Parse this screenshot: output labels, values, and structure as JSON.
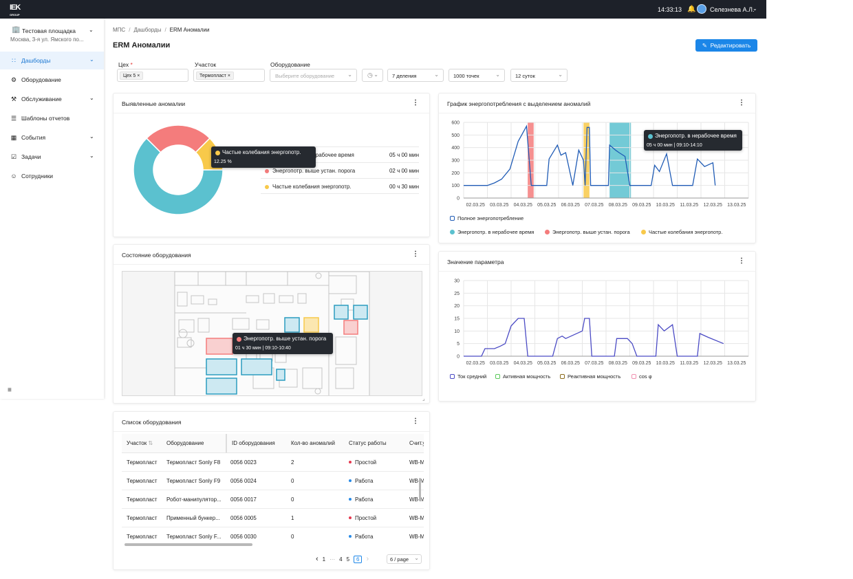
{
  "topbar": {
    "logo": "IEK",
    "logo_sub": "GROUP",
    "time": "14:33:13",
    "user": "Селезнева А.Л."
  },
  "sidebar": {
    "org_name": "Тестовая площадка",
    "org_address": "Москва, 3-я ул. Ямского по...",
    "items": [
      {
        "label": "Дашборды",
        "icon": "chart-icon",
        "expandable": true,
        "active": true
      },
      {
        "label": "Оборудование",
        "icon": "gear-icon",
        "expandable": false
      },
      {
        "label": "Обслуживание",
        "icon": "wrench-icon",
        "expandable": true
      },
      {
        "label": "Шаблоны отчетов",
        "icon": "document-icon",
        "expandable": false
      },
      {
        "label": "События",
        "icon": "calendar-icon",
        "expandable": true
      },
      {
        "label": "Задачи",
        "icon": "tasks-icon",
        "expandable": true
      },
      {
        "label": "Сотрудники",
        "icon": "user-icon",
        "expandable": false
      }
    ]
  },
  "breadcrumb": {
    "items": [
      "МПС",
      "Дашборды",
      "ERM Аномалии"
    ]
  },
  "page": {
    "title": "ERM Аномалии",
    "edit_label": "Редактировать"
  },
  "filters": {
    "workshop": {
      "label": "Цех",
      "required_mark": "*",
      "tag": "Цех 5"
    },
    "area": {
      "label": "Участок",
      "tag": "Термопласт"
    },
    "equipment": {
      "label": "Оборудование",
      "placeholder": "Выберите оборудование"
    },
    "divisions": "7 деления",
    "points": "1000 точек",
    "period": "12 суток"
  },
  "anomalies": {
    "title": "Выявленные аномалии",
    "legend": [
      {
        "name": "Энергопотр. в нерабочее время",
        "duration": "05 ч 00 мин",
        "color": "#5bc1cf"
      },
      {
        "name": "Энергопотр. выше устан. порога",
        "duration": "02 ч 00 мин",
        "color": "#f47c7c"
      },
      {
        "name": "Частые колебания энергопотр.",
        "duration": "00 ч 30 мин",
        "color": "#f8c94a"
      }
    ],
    "shares": [
      62.5,
      25,
      12.5
    ],
    "tooltip": {
      "name": "Частые колебания энергопотр.",
      "value": "12.25 %"
    }
  },
  "energy_chart": {
    "title": "График энергопотребления с выделением аномалий",
    "legend_total": "Полное энергопотребление",
    "tooltip": {
      "name": "Энергопотр. в нерабочее время",
      "detail": "05 ч 00 мин | 09:10-14:10"
    }
  },
  "param_chart": {
    "title": "Значение параметра",
    "legend": [
      "Ток средний",
      "Активная мощность",
      "Реактивная мощность",
      "cos φ"
    ],
    "legend_colors": [
      "#4a4ac4",
      "#5ac85a",
      "#8a6a1a",
      "#f090b0"
    ]
  },
  "chart_data": [
    {
      "type": "line",
      "title": "График энергопотребления с выделением аномалий",
      "x": [
        "02.03.25",
        "03.03.25",
        "04.03.25",
        "05.03.25",
        "06.03.25",
        "07.03.25",
        "08.03.25",
        "09.03.25",
        "10.03.25",
        "11.03.25",
        "12.03.25",
        "13.03.25"
      ],
      "ylim": [
        0,
        600
      ],
      "yticks": [
        0,
        100,
        200,
        300,
        400,
        500,
        600
      ],
      "xlim": [
        0,
        12
      ],
      "grid": true,
      "series": [
        {
          "name": "Полное энергопотребление",
          "color": "#1f5bb5",
          "points": [
            [
              0,
              100
            ],
            [
              1,
              100
            ],
            [
              1.3,
              120
            ],
            [
              1.6,
              150
            ],
            [
              1.95,
              230
            ],
            [
              2.3,
              450
            ],
            [
              2.65,
              570
            ],
            [
              2.85,
              100
            ],
            [
              3.5,
              100
            ],
            [
              3.6,
              310
            ],
            [
              3.95,
              420
            ],
            [
              4.1,
              340
            ],
            [
              4.3,
              360
            ],
            [
              4.6,
              100
            ],
            [
              4.85,
              380
            ],
            [
              5.05,
              300
            ],
            [
              5.12,
              100
            ],
            [
              5.2,
              560
            ],
            [
              5.3,
              560
            ],
            [
              5.35,
              100
            ],
            [
              6.1,
              100
            ],
            [
              6.15,
              420
            ],
            [
              6.4,
              380
            ],
            [
              6.55,
              360
            ],
            [
              6.8,
              330
            ],
            [
              7.0,
              100
            ],
            [
              7.9,
              100
            ],
            [
              8.05,
              260
            ],
            [
              8.25,
              210
            ],
            [
              8.55,
              350
            ],
            [
              8.8,
              100
            ],
            [
              9.65,
              100
            ],
            [
              9.85,
              310
            ],
            [
              10.15,
              250
            ],
            [
              10.5,
              280
            ],
            [
              10.6,
              100
            ]
          ]
        }
      ],
      "anomaly_bands": [
        {
          "series": "Энергопотр. выше устан. порога",
          "color": "#f47c7c",
          "from": 2.7,
          "to": 2.95
        },
        {
          "series": "Частые колебания энергопотр.",
          "color": "#f8c94a",
          "from": 5.05,
          "to": 5.3
        },
        {
          "series": "Энергопотр. в нерабочее время",
          "color": "#5bc1cf",
          "from": 6.15,
          "to": 7.05
        }
      ],
      "legend": [
        "Полное энергопотребление",
        "Энергопотр. в нерабочее время",
        "Энергопотр. выше устан. порога",
        "Частые колебания энергопотр."
      ]
    },
    {
      "type": "line",
      "title": "Значение параметра",
      "x": [
        "02.03.25",
        "03.03.25",
        "04.03.25",
        "05.03.25",
        "06.03.25",
        "07.03.25",
        "08.03.25",
        "09.03.25",
        "10.03.25",
        "11.03.25",
        "12.03.25",
        "13.03.25"
      ],
      "ylim": [
        0,
        30
      ],
      "yticks": [
        0,
        5,
        10,
        15,
        20,
        25,
        30
      ],
      "xlim": [
        0,
        12
      ],
      "grid": true,
      "series": [
        {
          "name": "Ток средний",
          "color": "#4a4ac4",
          "points": [
            [
              0,
              0
            ],
            [
              0.75,
              0
            ],
            [
              0.9,
              3
            ],
            [
              1.3,
              3
            ],
            [
              1.55,
              4
            ],
            [
              1.75,
              5
            ],
            [
              2.0,
              12
            ],
            [
              2.3,
              15
            ],
            [
              2.55,
              15
            ],
            [
              2.7,
              0
            ],
            [
              3.75,
              0
            ],
            [
              3.95,
              7
            ],
            [
              4.15,
              8
            ],
            [
              4.3,
              7
            ],
            [
              5.0,
              10
            ],
            [
              5.1,
              15
            ],
            [
              5.3,
              15
            ],
            [
              5.4,
              0
            ],
            [
              6.35,
              0
            ],
            [
              6.45,
              7
            ],
            [
              6.9,
              7
            ],
            [
              7.1,
              5
            ],
            [
              7.3,
              0
            ],
            [
              8.1,
              0
            ],
            [
              8.2,
              12.5
            ],
            [
              8.45,
              10
            ],
            [
              8.8,
              12.5
            ],
            [
              9.0,
              0
            ],
            [
              9.85,
              0
            ],
            [
              9.95,
              9
            ],
            [
              10.3,
              7.5
            ],
            [
              10.95,
              5
            ]
          ]
        }
      ],
      "legend": [
        "Ток средний",
        "Активная мощность",
        "Реактивная мощность",
        "cos φ"
      ]
    }
  ],
  "floorplan": {
    "title": "Состояние оборудования",
    "tooltip": {
      "name": "Энергопотр. выше устан. порога",
      "detail": "01 ч 30 мин | 09:10-10:40",
      "color": "#f47c7c"
    }
  },
  "equipment_list": {
    "title": "Список оборудования",
    "columns": [
      "Участок",
      "Оборудование",
      "ID оборудования",
      "Кол-во аномалий",
      "Статус работы",
      "Счит.у"
    ],
    "rows": [
      [
        "Термопласт",
        "Термопласт Sonly F8",
        "0056 0023",
        "2",
        "Простой",
        "WB-M"
      ],
      [
        "Термопласт",
        "Термопласт Sonly F9",
        "0056 0024",
        "0",
        "Работа",
        "WB-M"
      ],
      [
        "Термопласт",
        "Робот-манипулятор...",
        "0056 0017",
        "0",
        "Работа",
        "WB-M"
      ],
      [
        "Термопласт",
        "Применный бункер...",
        "0056 0005",
        "1",
        "Простой",
        "WB-M"
      ],
      [
        "Термопласт",
        "Термопласт Sonly F...",
        "0056 0030",
        "0",
        "Работа",
        "WB-M"
      ]
    ],
    "status_colors": {
      "Простой": "#e53950",
      "Работа": "#2a8be6"
    },
    "pager": {
      "pages": [
        "1",
        "···",
        "4",
        "5",
        "6"
      ],
      "current": "6",
      "page_size": "6 / page"
    }
  }
}
